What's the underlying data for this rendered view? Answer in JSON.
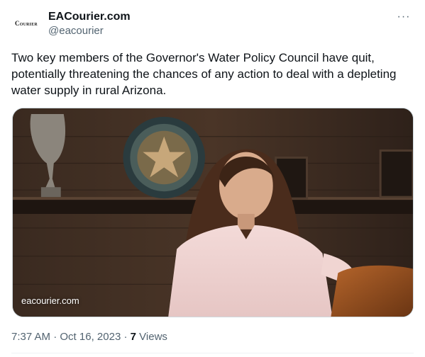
{
  "author": {
    "display_name": "EACourier.com",
    "handle": "@eacourier",
    "avatar_text": "Courier"
  },
  "more_icon": "···",
  "tweet": {
    "text": "Two key members of the Governor's Water Policy Council have quit, potentially threatening the chances of any action to deal with a depleting water supply in rural Arizona."
  },
  "media": {
    "link_badge": "eacourier.com"
  },
  "meta": {
    "time": "7:37 AM",
    "separator": "·",
    "date": "Oct 16, 2023",
    "views_count": "7",
    "views_label": "Views"
  }
}
